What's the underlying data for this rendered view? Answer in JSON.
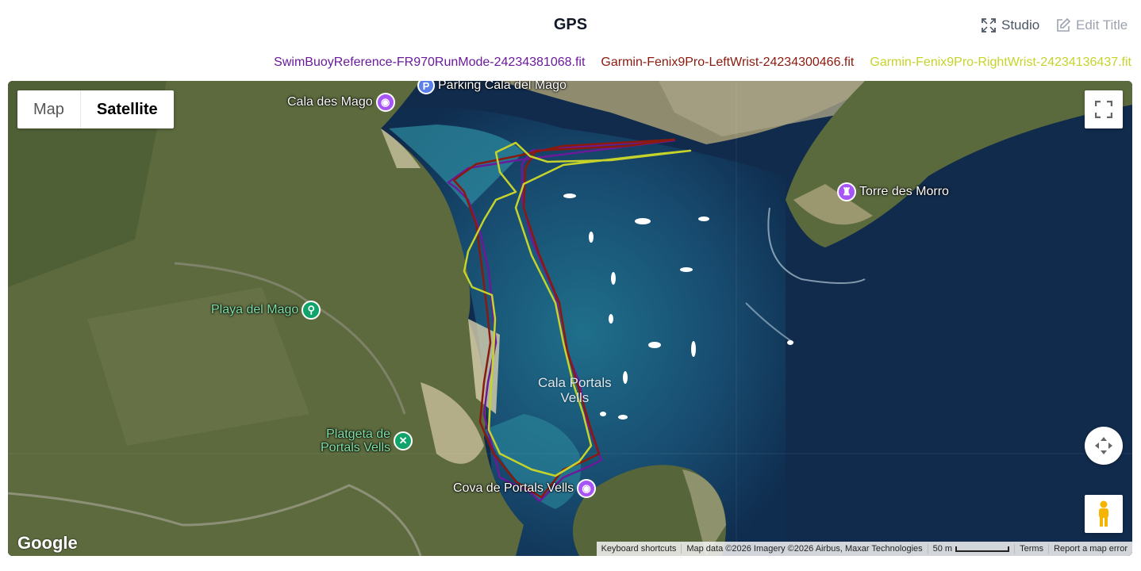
{
  "header": {
    "title": "GPS",
    "studio_label": "Studio",
    "studio_icon": "expand-icon",
    "edit_title_label": "Edit Title",
    "edit_icon": "pencil-icon"
  },
  "legend": [
    {
      "label": "SwimBuoyReference-FR970RunMode-24234381068.fit",
      "color": "#6b1a9b"
    },
    {
      "label": "Garmin-Fenix9Pro-LeftWrist-24234300466.fit",
      "color": "#8b1a0e"
    },
    {
      "label": "Garmin-Fenix9Pro-RightWrist-24234136437.fit",
      "color": "#c5d32a"
    }
  ],
  "map": {
    "type_buttons": {
      "map": "Map",
      "satellite": "Satellite",
      "selected": "Satellite"
    },
    "pois": {
      "parking": {
        "label": "Parking Cala del Mago",
        "icon_letter": "P"
      },
      "cala_des_mago": "Cala des Mago",
      "torre_des_morro": "Torre des Morro",
      "playa_del_mago": "Playa del Mago",
      "platgeta_line1": "Platgeta de",
      "platgeta_line2": "Portals Vells",
      "cova": "Cova de Portals Vells"
    },
    "water_label_line1": "Cala Portals",
    "water_label_line2": "Vells",
    "logo": "Google",
    "attribution": {
      "keyboard": "Keyboard shortcuts",
      "data": "Map data ©2026 Imagery ©2026 Airbus, Maxar Technologies",
      "scale": "50 m",
      "terms": "Terms",
      "report": "Report a map error"
    }
  }
}
